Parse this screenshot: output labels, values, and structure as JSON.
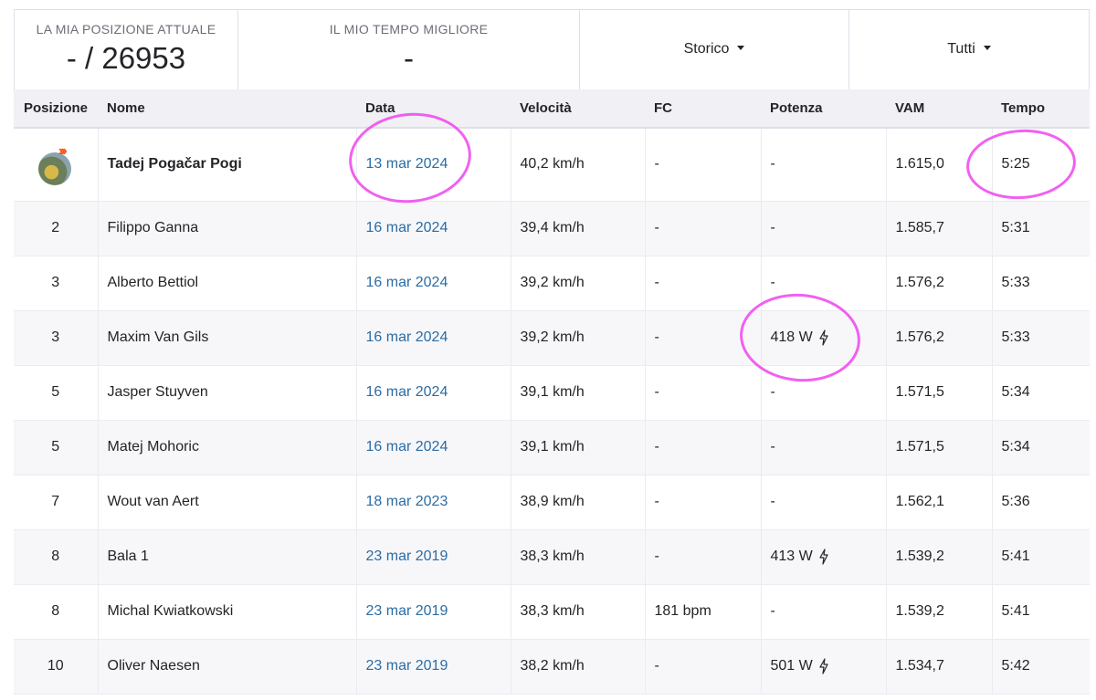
{
  "stats": {
    "position_label": "LA MIA POSIZIONE ATTUALE",
    "position_value": "- / 26953",
    "best_label": "IL MIO TEMPO MIGLIORE",
    "best_value": "-"
  },
  "filters": {
    "history": "Storico",
    "all": "Tutti"
  },
  "columns": [
    "Posizione",
    "Nome",
    "Data",
    "Velocità",
    "FC",
    "Potenza",
    "VAM",
    "Tempo"
  ],
  "rows": [
    {
      "pos": "",
      "name": "Tadej Pogačar Pogi",
      "date": "13 mar 2024",
      "speed": "40,2 km/h",
      "hr": "-",
      "power": "-",
      "vam": "1.615,0",
      "time": "5:25"
    },
    {
      "pos": "2",
      "name": "Filippo Ganna",
      "date": "16 mar 2024",
      "speed": "39,4 km/h",
      "hr": "-",
      "power": "-",
      "vam": "1.585,7",
      "time": "5:31"
    },
    {
      "pos": "3",
      "name": "Alberto Bettiol",
      "date": "16 mar 2024",
      "speed": "39,2 km/h",
      "hr": "-",
      "power": "-",
      "vam": "1.576,2",
      "time": "5:33"
    },
    {
      "pos": "3",
      "name": "Maxim Van Gils",
      "date": "16 mar 2024",
      "speed": "39,2 km/h",
      "hr": "-",
      "power": "418 W",
      "vam": "1.576,2",
      "time": "5:33"
    },
    {
      "pos": "5",
      "name": "Jasper Stuyven",
      "date": "16 mar 2024",
      "speed": "39,1 km/h",
      "hr": "-",
      "power": "-",
      "vam": "1.571,5",
      "time": "5:34"
    },
    {
      "pos": "5",
      "name": "Matej Mohoric",
      "date": "16 mar 2024",
      "speed": "39,1 km/h",
      "hr": "-",
      "power": "-",
      "vam": "1.571,5",
      "time": "5:34"
    },
    {
      "pos": "7",
      "name": "Wout van Aert",
      "date": "18 mar 2023",
      "speed": "38,9 km/h",
      "hr": "-",
      "power": "-",
      "vam": "1.562,1",
      "time": "5:36"
    },
    {
      "pos": "8",
      "name": "Bala 1",
      "date": "23 mar 2019",
      "speed": "38,3 km/h",
      "hr": "-",
      "power": "413 W",
      "vam": "1.539,2",
      "time": "5:41"
    },
    {
      "pos": "8",
      "name": "Michal Kwiatkowski",
      "date": "23 mar 2019",
      "speed": "38,3 km/h",
      "hr": "181 bpm",
      "power": "-",
      "vam": "1.539,2",
      "time": "5:41"
    },
    {
      "pos": "10",
      "name": "Oliver Naesen",
      "date": "23 mar 2019",
      "speed": "38,2 km/h",
      "hr": "-",
      "power": "501 W",
      "vam": "1.534,7",
      "time": "5:42"
    }
  ],
  "colors": {
    "link": "#2b6ca3",
    "annotation": "#ee44ee",
    "header_bg": "#f0f0f5",
    "brand": "#fc4c02"
  }
}
